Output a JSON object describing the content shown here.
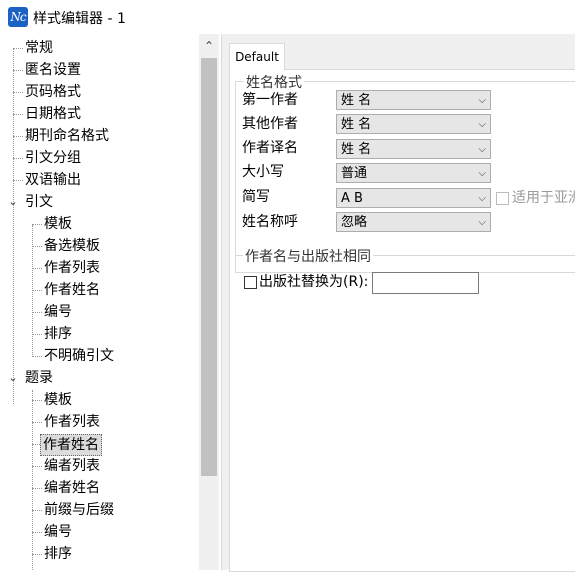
{
  "window": {
    "title": "样式编辑器 - 1",
    "icon": "Nc"
  },
  "tree": {
    "items": [
      {
        "label": "常规"
      },
      {
        "label": "匿名设置"
      },
      {
        "label": "页码格式"
      },
      {
        "label": "日期格式"
      },
      {
        "label": "期刊命名格式"
      },
      {
        "label": "引文分组"
      },
      {
        "label": "双语输出"
      },
      {
        "label": "引文",
        "expanded": true,
        "children": [
          {
            "label": "模板"
          },
          {
            "label": "备选模板"
          },
          {
            "label": "作者列表"
          },
          {
            "label": "作者姓名"
          },
          {
            "label": "编号"
          },
          {
            "label": "排序"
          },
          {
            "label": "不明确引文"
          }
        ]
      },
      {
        "label": "题录",
        "expanded": true,
        "children": [
          {
            "label": "模板"
          },
          {
            "label": "作者列表"
          },
          {
            "label": "作者姓名",
            "selected": true
          },
          {
            "label": "编者列表"
          },
          {
            "label": "编者姓名"
          },
          {
            "label": "前缀与后缀"
          },
          {
            "label": "编号"
          },
          {
            "label": "排序"
          }
        ]
      }
    ]
  },
  "tabs": [
    {
      "label": "Default",
      "active": true
    }
  ],
  "name_format": {
    "title": "姓名格式",
    "rows": [
      {
        "label": "第一作者",
        "value": "姓 名"
      },
      {
        "label": "其他作者",
        "value": "姓 名"
      },
      {
        "label": "作者译名",
        "value": "姓 名"
      },
      {
        "label": "大小写",
        "value": "普通"
      },
      {
        "label": "简写",
        "value": "A B"
      },
      {
        "label": "姓名称呼",
        "value": "忽略"
      }
    ],
    "asian_checkbox": {
      "label": "适用于亚洲",
      "checked": false,
      "disabled": true
    }
  },
  "publisher_group": {
    "title": "作者名与出版社相同",
    "checkbox_label": "出版社替换为(R):",
    "checked": false,
    "input_value": ""
  },
  "icons": {
    "expander": "chevron-down",
    "scroll_up": "chevron-up",
    "combo": "chevron-down"
  }
}
